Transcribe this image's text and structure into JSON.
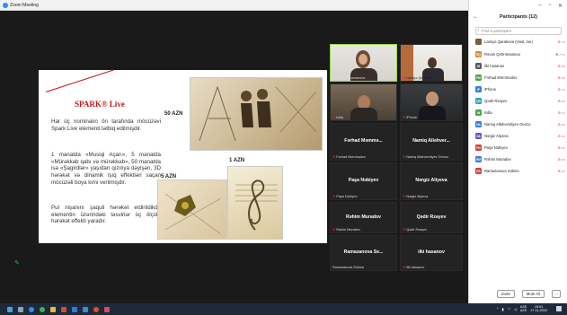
{
  "window": {
    "title": "Zoom Meeting"
  },
  "slide": {
    "title": "SPARK® Live",
    "paragraphs": [
      "Har üç nominalın ön tarafında möcüzəvi Spark Live elementi tətbiq edilmişdir.",
      "1 manatda «Musiqi Açarı», 5 manatda «Mürəkkəb qabı və mürəkkəb», 50 manatda isə «Şagirdlər» yaşıdan qızılıya dəyişən, 3D hərəkət və dinamik işıq effektləri saçan möcüzəli boya kimi verilmişdir.",
      "Pul nişanını şaquli hərəkət etdirildikdə elementin üzərindəki təsvirlər üç ölçülü hərəkət effekti yaradır."
    ],
    "prices": {
      "p50": "50 AZN",
      "p5": "5 AZN",
      "p1": "1 AZN"
    }
  },
  "tiles": [
    {
      "label": "Rəvan Qəhrəmanova",
      "video": true
    },
    {
      "label": "Lamiyə Qarabova",
      "video": true
    },
    {
      "label": "Inilla",
      "video": true
    },
    {
      "label": "iPhone",
      "video": true
    },
    {
      "big": "Fərhad Məmmə...",
      "label": "Fərhad Məmmədov"
    },
    {
      "big": "Namiq Alləhver...",
      "label": "Namiq Allahverdiyev Genco"
    },
    {
      "big": "Paşa Nəbiyev",
      "label": "Paşa Nəbiyev"
    },
    {
      "big": "Nərgiz Aliyeva",
      "label": "Nərgiz Aliyeva"
    },
    {
      "big": "Rəhim Muradov",
      "label": "Rəhim Muradov"
    },
    {
      "big": "Qədir Rzayev",
      "label": "Qədir Rzayev"
    },
    {
      "big": "Ramazanova Se...",
      "label": "Ramazanova Səkinə"
    },
    {
      "big": "ilkì hasanov",
      "label": "ilkì hasanov"
    }
  ],
  "participants_panel": {
    "title": "Participants (12)",
    "search_placeholder": "Find a participant",
    "list": [
      {
        "initials": "",
        "name": "Lamiyə Qarabova (Host, me)",
        "color": "#7a5c3a"
      },
      {
        "initials": "RQ",
        "name": "Rəvan Qəhrəmanova",
        "color": "#d9893c"
      },
      {
        "initials": "iH",
        "name": "ilkì hasanov",
        "color": "#5b5b5b"
      },
      {
        "initials": "FM",
        "name": "Fərhad Məmmədov",
        "color": "#4da34d"
      },
      {
        "initials": "iP",
        "name": "iPhone",
        "color": "#3b7dd8"
      },
      {
        "initials": "QR",
        "name": "Qədir Rzayev",
        "color": "#2ca0b8"
      },
      {
        "initials": "IN",
        "name": "Inilla",
        "color": "#4da34d"
      },
      {
        "initials": "NA",
        "name": "Namiq Allahverdiyev Genco",
        "color": "#3b7dd8"
      },
      {
        "initials": "NA",
        "name": "Nərgiz Aliyeva",
        "color": "#6a55c2"
      },
      {
        "initials": "PN",
        "name": "Paşa Nəbiyev",
        "color": "#d63b3b"
      },
      {
        "initials": "RM",
        "name": "Rəhim Muradov",
        "color": "#3b7dd8"
      },
      {
        "initials": "RS",
        "name": "Ramazanova Səkinə",
        "color": "#d63b3b"
      }
    ],
    "buttons": {
      "invite": "Invite",
      "mute_all": "Mute All",
      "more": "..."
    }
  },
  "taskbar": {
    "language": "AZE\nAZE",
    "time": "19:01",
    "date": "17.11.2022"
  }
}
